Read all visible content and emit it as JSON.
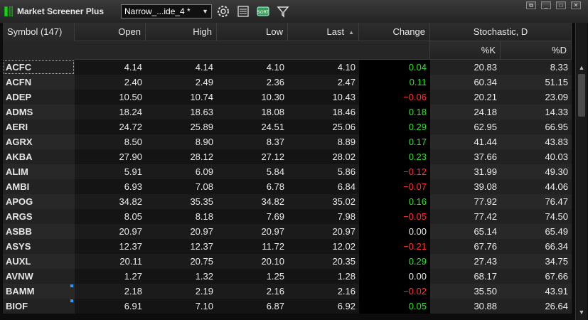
{
  "app": {
    "title": "Market Screener Plus"
  },
  "toolbar": {
    "layout_value": "Narrow_...ide_4 *"
  },
  "columns": {
    "symbol": "Symbol (147)",
    "open": "Open",
    "high": "High",
    "low": "Low",
    "last": "Last",
    "change": "Change",
    "stochastic": "Stochastic, D",
    "k": "%K",
    "d": "%D"
  },
  "rows": [
    {
      "symbol": "ACFC",
      "open": "4.14",
      "high": "4.14",
      "low": "4.10",
      "last": "4.10",
      "change": "0.04",
      "k": "20.83",
      "d": "8.33",
      "dir": "pos"
    },
    {
      "symbol": "ACFN",
      "open": "2.40",
      "high": "2.49",
      "low": "2.36",
      "last": "2.47",
      "change": "0.11",
      "k": "60.34",
      "d": "51.15",
      "dir": "pos"
    },
    {
      "symbol": "ADEP",
      "open": "10.50",
      "high": "10.74",
      "low": "10.30",
      "last": "10.43",
      "change": "−0.06",
      "k": "20.21",
      "d": "23.09",
      "dir": "neg"
    },
    {
      "symbol": "ADMS",
      "open": "18.24",
      "high": "18.63",
      "low": "18.08",
      "last": "18.46",
      "change": "0.18",
      "k": "24.18",
      "d": "14.33",
      "dir": "pos"
    },
    {
      "symbol": "AERI",
      "open": "24.72",
      "high": "25.89",
      "low": "24.51",
      "last": "25.06",
      "change": "0.29",
      "k": "62.95",
      "d": "66.95",
      "dir": "pos"
    },
    {
      "symbol": "AGRX",
      "open": "8.50",
      "high": "8.90",
      "low": "8.37",
      "last": "8.89",
      "change": "0.17",
      "k": "41.44",
      "d": "43.83",
      "dir": "pos"
    },
    {
      "symbol": "AKBA",
      "open": "27.90",
      "high": "28.12",
      "low": "27.12",
      "last": "28.02",
      "change": "0.23",
      "k": "37.66",
      "d": "40.03",
      "dir": "pos"
    },
    {
      "symbol": "ALIM",
      "open": "5.91",
      "high": "6.09",
      "low": "5.84",
      "last": "5.86",
      "change": "−0.12",
      "k": "31.99",
      "d": "49.30",
      "dir": "neg"
    },
    {
      "symbol": "AMBI",
      "open": "6.93",
      "high": "7.08",
      "low": "6.78",
      "last": "6.84",
      "change": "−0.07",
      "k": "39.08",
      "d": "44.06",
      "dir": "neg"
    },
    {
      "symbol": "APOG",
      "open": "34.82",
      "high": "35.35",
      "low": "34.82",
      "last": "35.02",
      "change": "0.16",
      "k": "77.92",
      "d": "76.47",
      "dir": "pos"
    },
    {
      "symbol": "ARGS",
      "open": "8.05",
      "high": "8.18",
      "low": "7.69",
      "last": "7.98",
      "change": "−0.05",
      "k": "77.42",
      "d": "74.50",
      "dir": "neg"
    },
    {
      "symbol": "ASBB",
      "open": "20.97",
      "high": "20.97",
      "low": "20.97",
      "last": "20.97",
      "change": "0.00",
      "k": "65.14",
      "d": "65.49",
      "dir": "zero"
    },
    {
      "symbol": "ASYS",
      "open": "12.37",
      "high": "12.37",
      "low": "11.72",
      "last": "12.02",
      "change": "−0.21",
      "k": "67.76",
      "d": "66.34",
      "dir": "neg"
    },
    {
      "symbol": "AUXL",
      "open": "20.11",
      "high": "20.75",
      "low": "20.10",
      "last": "20.35",
      "change": "0.29",
      "k": "27.43",
      "d": "34.75",
      "dir": "pos"
    },
    {
      "symbol": "AVNW",
      "open": "1.27",
      "high": "1.32",
      "low": "1.25",
      "last": "1.28",
      "change": "0.00",
      "k": "68.17",
      "d": "67.66",
      "dir": "zero"
    },
    {
      "symbol": "BAMM",
      "open": "2.18",
      "high": "2.19",
      "low": "2.16",
      "last": "2.16",
      "change": "−0.02",
      "k": "35.50",
      "d": "43.91",
      "dir": "neg",
      "marker": true
    },
    {
      "symbol": "BIOF",
      "open": "6.91",
      "high": "7.10",
      "low": "6.87",
      "last": "6.92",
      "change": "0.05",
      "k": "30.88",
      "d": "26.64",
      "dir": "pos",
      "marker": true
    }
  ],
  "colors": {
    "positive": "#2de02d",
    "negative": "#ff3030",
    "accent": "#1ea0ff"
  },
  "icons": [
    "settings-gear-icon",
    "sheet-icon",
    "sort-icon",
    "filter-icon"
  ]
}
